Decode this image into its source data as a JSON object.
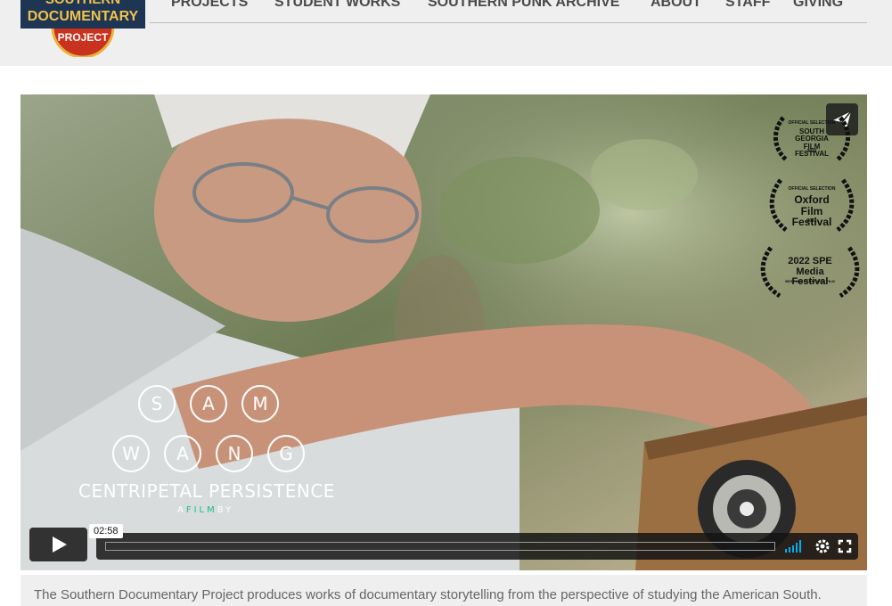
{
  "header": {
    "logo_lines": [
      "SOUTHERN",
      "DOCUMENTARY",
      "PROJECT"
    ],
    "nav": [
      {
        "label": "PROJECTS"
      },
      {
        "label": "STUDENT WORKS"
      },
      {
        "label": "SOUTHERN PUNK ARCHIVE"
      },
      {
        "label": "ABOUT"
      },
      {
        "label": "STAFF"
      },
      {
        "label": "GIVING"
      }
    ]
  },
  "video": {
    "title_letters_row1": [
      "S",
      "A",
      "M"
    ],
    "title_letters_row2": [
      "W",
      "A",
      "N",
      "G"
    ],
    "subtitle": "CENTRIPETAL PERSISTENCE",
    "film_by_prefix": "A",
    "film_by_accent": "FILM",
    "film_by_suffix": "BY",
    "laurels": [
      {
        "top": "OFFICIAL SELECTION",
        "main": "SOUTH GEORGIA FILM FESTIVAL",
        "bottom": "2022"
      },
      {
        "top": "OFFICIAL SELECTION",
        "main": "Oxford Film Festival",
        "bottom": "2022"
      },
      {
        "top": "",
        "main": "2022 SPE Media Festival",
        "bottom": "BEST MULTICULTURAL FILM"
      }
    ],
    "player": {
      "timecode": "02:58",
      "accent_color": "#00adef"
    }
  },
  "caption": {
    "text": "The Southern Documentary Project produces works of documentary storytelling from the perspective of studying the American South."
  }
}
